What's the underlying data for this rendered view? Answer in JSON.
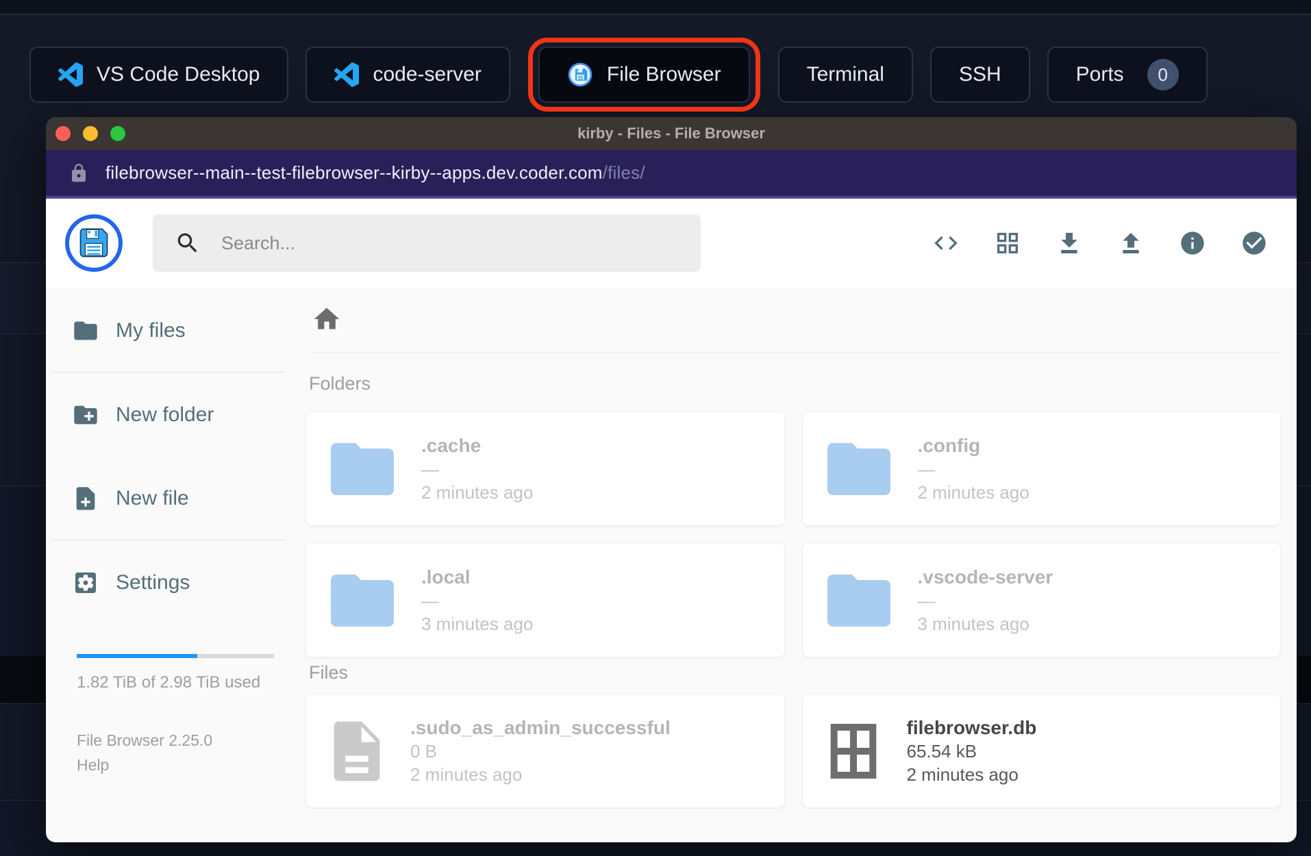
{
  "topbar": {
    "tabs": {
      "vscode_desktop": {
        "label": "VS Code Desktop",
        "icon": "vscode-icon"
      },
      "code_server": {
        "label": "code-server",
        "icon": "vscode-icon"
      },
      "file_browser": {
        "label": "File Browser",
        "icon": "filebrowser-icon",
        "active": true,
        "annotated": true
      },
      "terminal": {
        "label": "Terminal"
      },
      "ssh": {
        "label": "SSH"
      },
      "ports": {
        "label": "Ports",
        "badge": "0"
      }
    },
    "annotation_color": "#f03418"
  },
  "window": {
    "title": "kirby - Files - File Browser",
    "url": {
      "host": "filebrowser--main--test-filebrowser--kirby--apps.dev.coder.com",
      "path": "/files/"
    }
  },
  "toolbar": {
    "search_placeholder": "Search...",
    "icons": [
      "shell-icon",
      "grid-view-icon",
      "download-icon",
      "upload-icon",
      "info-icon",
      "select-multiple-icon"
    ]
  },
  "sidebar": {
    "items": [
      {
        "label": "My files",
        "icon": "folder-icon"
      },
      {
        "label": "New folder",
        "icon": "new-folder-icon"
      },
      {
        "label": "New file",
        "icon": "new-file-icon"
      },
      {
        "label": "Settings",
        "icon": "settings-icon"
      }
    ],
    "usage": {
      "label": "1.82 TiB of 2.98 TiB used",
      "percent": 61
    },
    "version": "File Browser 2.25.0",
    "help": "Help"
  },
  "listing": {
    "sections": [
      {
        "title": "Folders",
        "items": [
          {
            "name": ".cache",
            "size": "—",
            "modified": "2 minutes ago",
            "icon": "folder",
            "hidden": true
          },
          {
            "name": ".config",
            "size": "—",
            "modified": "2 minutes ago",
            "icon": "folder",
            "hidden": true
          },
          {
            "name": ".local",
            "size": "—",
            "modified": "3 minutes ago",
            "icon": "folder",
            "hidden": true
          },
          {
            "name": ".vscode-server",
            "size": "—",
            "modified": "3 minutes ago",
            "icon": "folder",
            "hidden": true
          }
        ]
      },
      {
        "title": "Files",
        "items": [
          {
            "name": ".sudo_as_admin_successful",
            "size": "0 B",
            "modified": "2 minutes ago",
            "icon": "file",
            "hidden": true
          },
          {
            "name": "filebrowser.db",
            "size": "65.54 kB",
            "modified": "2 minutes ago",
            "icon": "db-grid",
            "hidden": false
          }
        ]
      }
    ]
  },
  "colors": {
    "accent_blue": "#2196f3",
    "folder_blue": "#a9ccf1",
    "slate_icon": "#546e7a",
    "annotation_red": "#f03418",
    "urlbar_purple": "#2a2059",
    "titlebar_brown": "#3b3533"
  }
}
